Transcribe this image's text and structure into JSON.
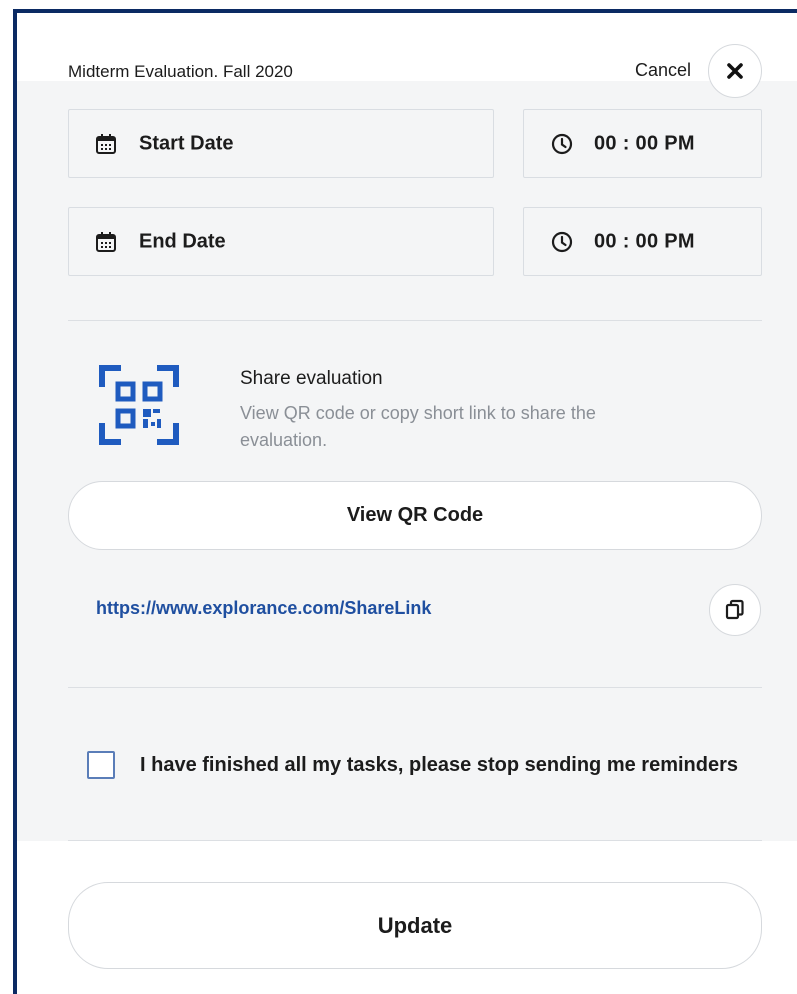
{
  "header": {
    "title": "Midterm Evaluation. Fall 2020",
    "cancel_label": "Cancel",
    "close_icon": "close-icon"
  },
  "schedule": {
    "start_date_label": "Start Date",
    "start_time": "00 : 00  PM",
    "end_date_label": "End Date",
    "end_time": "00 : 00  PM",
    "date_icon": "calendar-icon",
    "time_icon": "clock-icon"
  },
  "share": {
    "icon": "qr-code-icon",
    "title": "Share evaluation",
    "description": "View QR code or copy short link  to share the evaluation.",
    "view_qr_label": "View QR Code",
    "link": "https://www.explorance.com/ShareLink",
    "copy_icon": "copy-icon"
  },
  "reminders": {
    "checkbox_label": "I have finished all my tasks, please stop sending me reminders",
    "checked": false
  },
  "footer": {
    "update_label": "Update"
  },
  "colors": {
    "frame": "#0b2a63",
    "accent": "#1f5bbf",
    "link": "#1f4fa0",
    "panel_bg": "#f4f5f6"
  }
}
